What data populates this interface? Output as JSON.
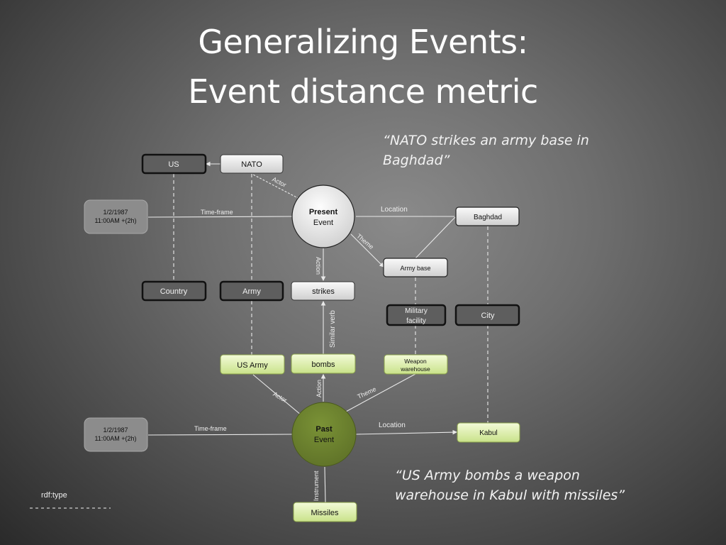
{
  "title": {
    "line1": "Generalizing Events:",
    "line2": "Event distance metric"
  },
  "quotes": {
    "present": "“NATO strikes an army base in Baghdad”",
    "past": "“US Army bombs a weapon warehouse in Kabul with missiles”"
  },
  "colors": {
    "class_node_border": "#111111",
    "instance_present_fill": "#e8e8e8",
    "instance_past_fill": "#e6f5b8",
    "past_event_fill": "#6b7f2e",
    "time_node_fill": "#8c8c8c"
  },
  "present_event": {
    "title": "Present",
    "subtitle": "Event"
  },
  "past_event": {
    "title": "Past",
    "subtitle": "Event"
  },
  "nodes": {
    "us": "US",
    "nato": "NATO",
    "present_time_line1": "1/2/1987",
    "present_time_line2": "11:00AM +(2h)",
    "baghdad": "Baghdad",
    "army_base": "Army base",
    "country": "Country",
    "army": "Army",
    "strikes": "strikes",
    "military_facility_line1": "Military",
    "military_facility_line2": "facility",
    "city": "City",
    "us_army": "US Army",
    "bombs": "bombs",
    "weapon_warehouse_line1": "Weapon",
    "weapon_warehouse_line2": "warehouse",
    "past_time_line1": "1/2/1987",
    "past_time_line2": "11:00AM +(2h)",
    "kabul": "Kabul",
    "missiles": "Missiles"
  },
  "edges": {
    "actor_present": "Actor",
    "timeframe_present": "Time-frame",
    "location_present": "Location",
    "theme_present": "Theme",
    "action_present": "Action",
    "similar_verb": "Similar verb",
    "action_past": "Action",
    "theme_past": "Theme",
    "actor_past": "Actor",
    "timeframe_past": "Time-frame",
    "location_past": "Location",
    "instrument_past": "Instrument"
  },
  "legend": {
    "rdf_type_label": "rdf:type"
  }
}
